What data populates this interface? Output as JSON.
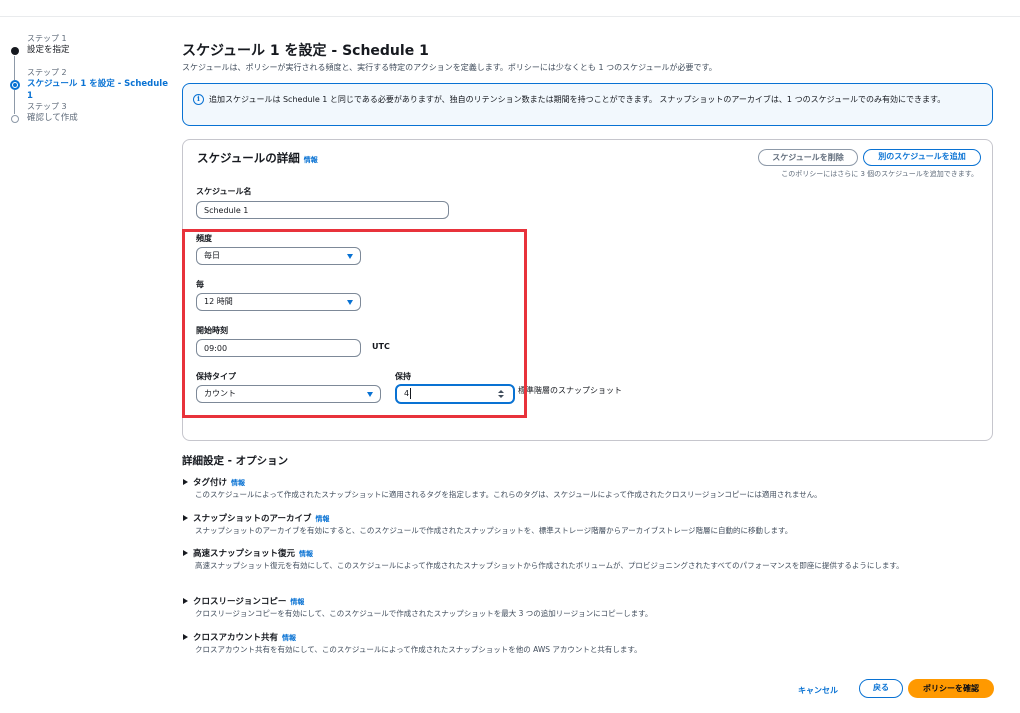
{
  "steps": [
    {
      "caption": "ステップ 1",
      "label": "設定を指定"
    },
    {
      "caption": "ステップ 2",
      "label": "スケジュール 1 を設定 - Schedule 1"
    },
    {
      "caption": "ステップ 3",
      "label": "確認して作成"
    }
  ],
  "header": {
    "title": "スケジュール 1 を設定 - Schedule 1",
    "description": "スケジュールは、ポリシーが実行される頻度と、実行する特定のアクションを定義します。ポリシーには少なくとも 1 つのスケジュールが必要です。"
  },
  "alert": {
    "text": "追加スケジュールは Schedule 1 と同じである必要がありますが、独自のリテンション数または期間を持つことができます。 スナップショットのアーカイブは、1 つのスケジュールでのみ有効にできます。"
  },
  "details": {
    "title": "スケジュールの詳細",
    "info": "情報",
    "delete_label": "スケジュールを削除",
    "add_label": "別のスケジュールを追加",
    "note": "このポリシーにはさらに 3 個のスケジュールを追加できます。",
    "name_label": "スケジュール名",
    "name_value": "Schedule 1",
    "frequency_label": "頻度",
    "frequency_value": "毎日",
    "every_label": "毎",
    "every_value": "12 時間",
    "start_label": "開始時刻",
    "start_value": "09:00",
    "timezone": "UTC",
    "retention_type_label": "保持タイプ",
    "retention_type_value": "カウント",
    "retain_label": "保持",
    "retain_value": "4",
    "retain_suffix": "標準階層のスナップショット"
  },
  "advanced": {
    "title": "詳細設定 - オプション",
    "items": [
      {
        "title": "タグ付け",
        "info": "情報",
        "desc": "このスケジュールによって作成されたスナップショットに適用されるタグを指定します。これらのタグは、スケジュールによって作成されたクロスリージョンコピーには適用されません。"
      },
      {
        "title": "スナップショットのアーカイブ",
        "info": "情報",
        "desc": "スナップショットのアーカイブを有効にすると、このスケジュールで作成されたスナップショットを、標準ストレージ階層からアーカイブストレージ階層に自動的に移動します。"
      },
      {
        "title": "高速スナップショット復元",
        "info": "情報",
        "desc": "高速スナップショット復元を有効にして、このスケジュールによって作成されたスナップショットから作成されたボリュームが、プロビジョニングされたすべてのパフォーマンスを即座に提供するようにします。"
      },
      {
        "title": "クロスリージョンコピー",
        "info": "情報",
        "desc": "クロスリージョンコピーを有効にして、このスケジュールで作成されたスナップショットを最大 3 つの追加リージョンにコピーします。"
      },
      {
        "title": "クロスアカウント共有",
        "info": "情報",
        "desc": "クロスアカウント共有を有効にして、このスケジュールによって作成されたスナップショットを他の AWS アカウントと共有します。"
      }
    ]
  },
  "footer": {
    "cancel": "キャンセル",
    "back": "戻る",
    "confirm": "ポリシーを確認"
  },
  "colors": {
    "accent": "#0972d3",
    "primary": "#ff9900",
    "highlight": "#e8323b"
  }
}
